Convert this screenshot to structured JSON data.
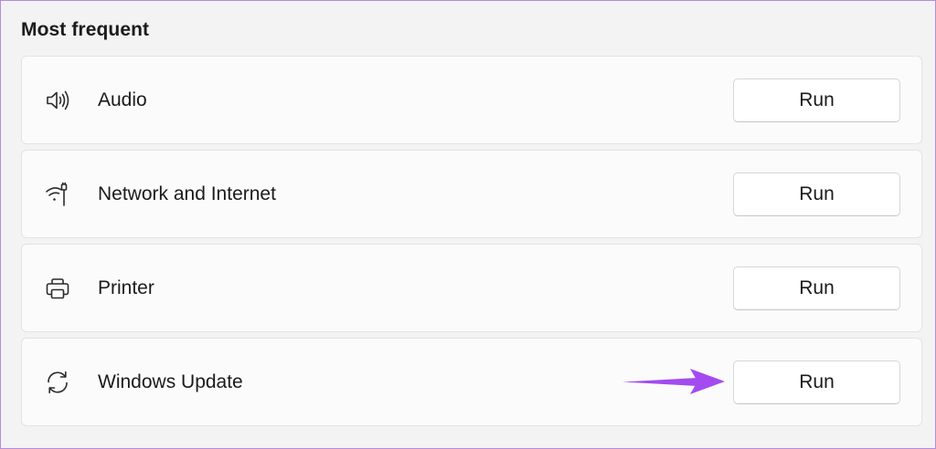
{
  "section": {
    "title": "Most frequent"
  },
  "items": [
    {
      "label": "Audio",
      "icon": "speaker-icon",
      "button": "Run"
    },
    {
      "label": "Network and Internet",
      "icon": "network-icon",
      "button": "Run"
    },
    {
      "label": "Printer",
      "icon": "printer-icon",
      "button": "Run"
    },
    {
      "label": "Windows Update",
      "icon": "sync-icon",
      "button": "Run"
    }
  ],
  "annotation": {
    "icon": "arrow-icon",
    "color": "#a34bf0"
  }
}
